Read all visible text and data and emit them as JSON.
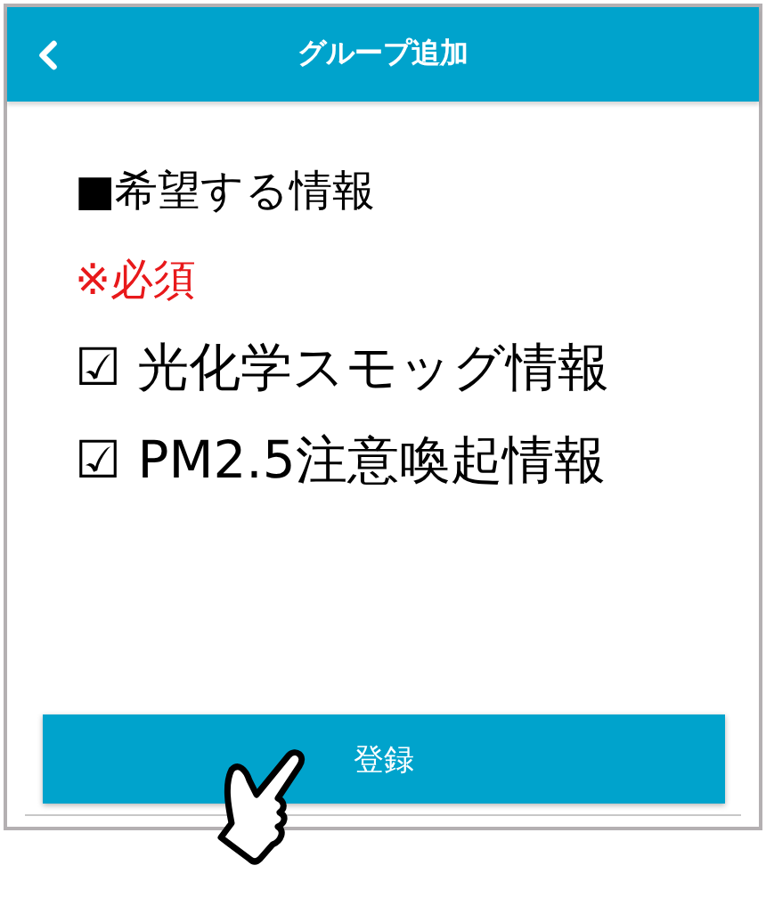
{
  "header": {
    "title": "グループ追加"
  },
  "section_title": "■希望する情報",
  "required_note": "※必須",
  "options": [
    {
      "label": "☑ 光化学スモッグ情報"
    },
    {
      "label": "☑ PM2.5注意喚起情報"
    }
  ],
  "submit_button": "登録"
}
